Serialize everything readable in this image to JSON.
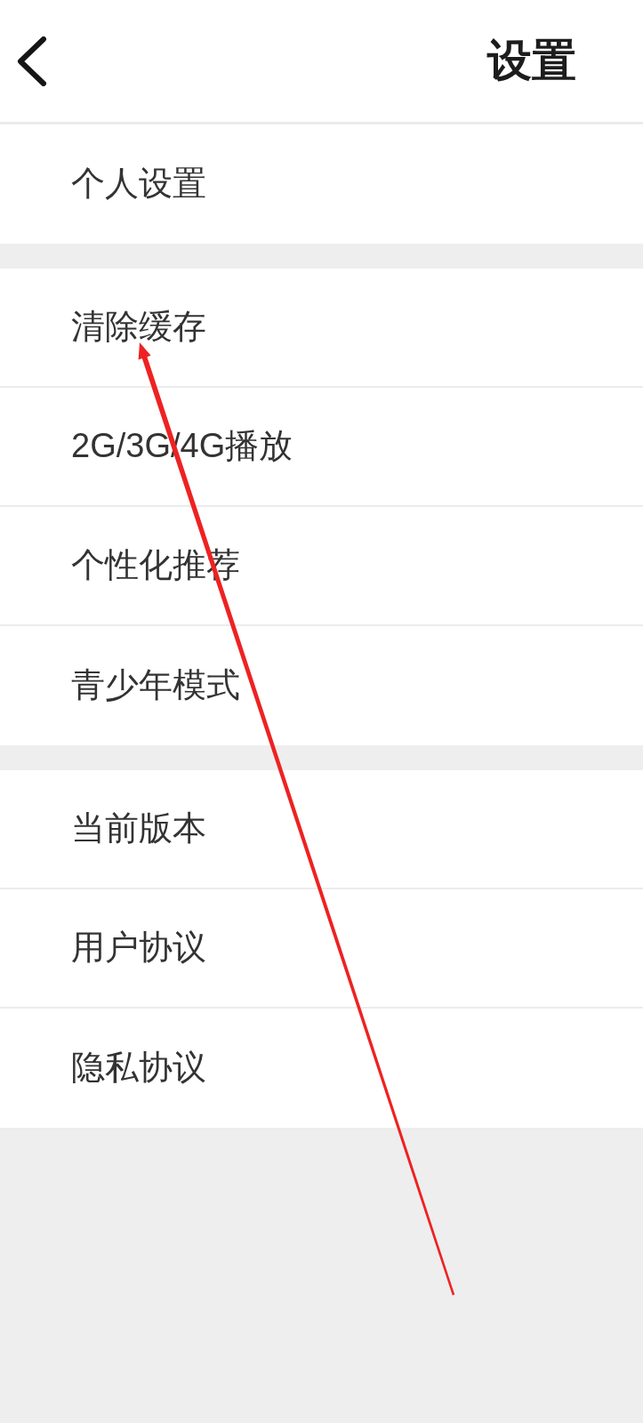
{
  "header": {
    "title": "设置"
  },
  "sections": [
    {
      "items": [
        {
          "label": "个人设置"
        }
      ]
    },
    {
      "items": [
        {
          "label": "清除缓存"
        },
        {
          "label": "2G/3G/4G播放"
        },
        {
          "label": "个性化推荐"
        },
        {
          "label": "青少年模式"
        }
      ]
    },
    {
      "items": [
        {
          "label": "当前版本"
        },
        {
          "label": "用户协议"
        },
        {
          "label": "隐私协议"
        }
      ]
    }
  ],
  "annotation": {
    "kind": "arrow"
  }
}
